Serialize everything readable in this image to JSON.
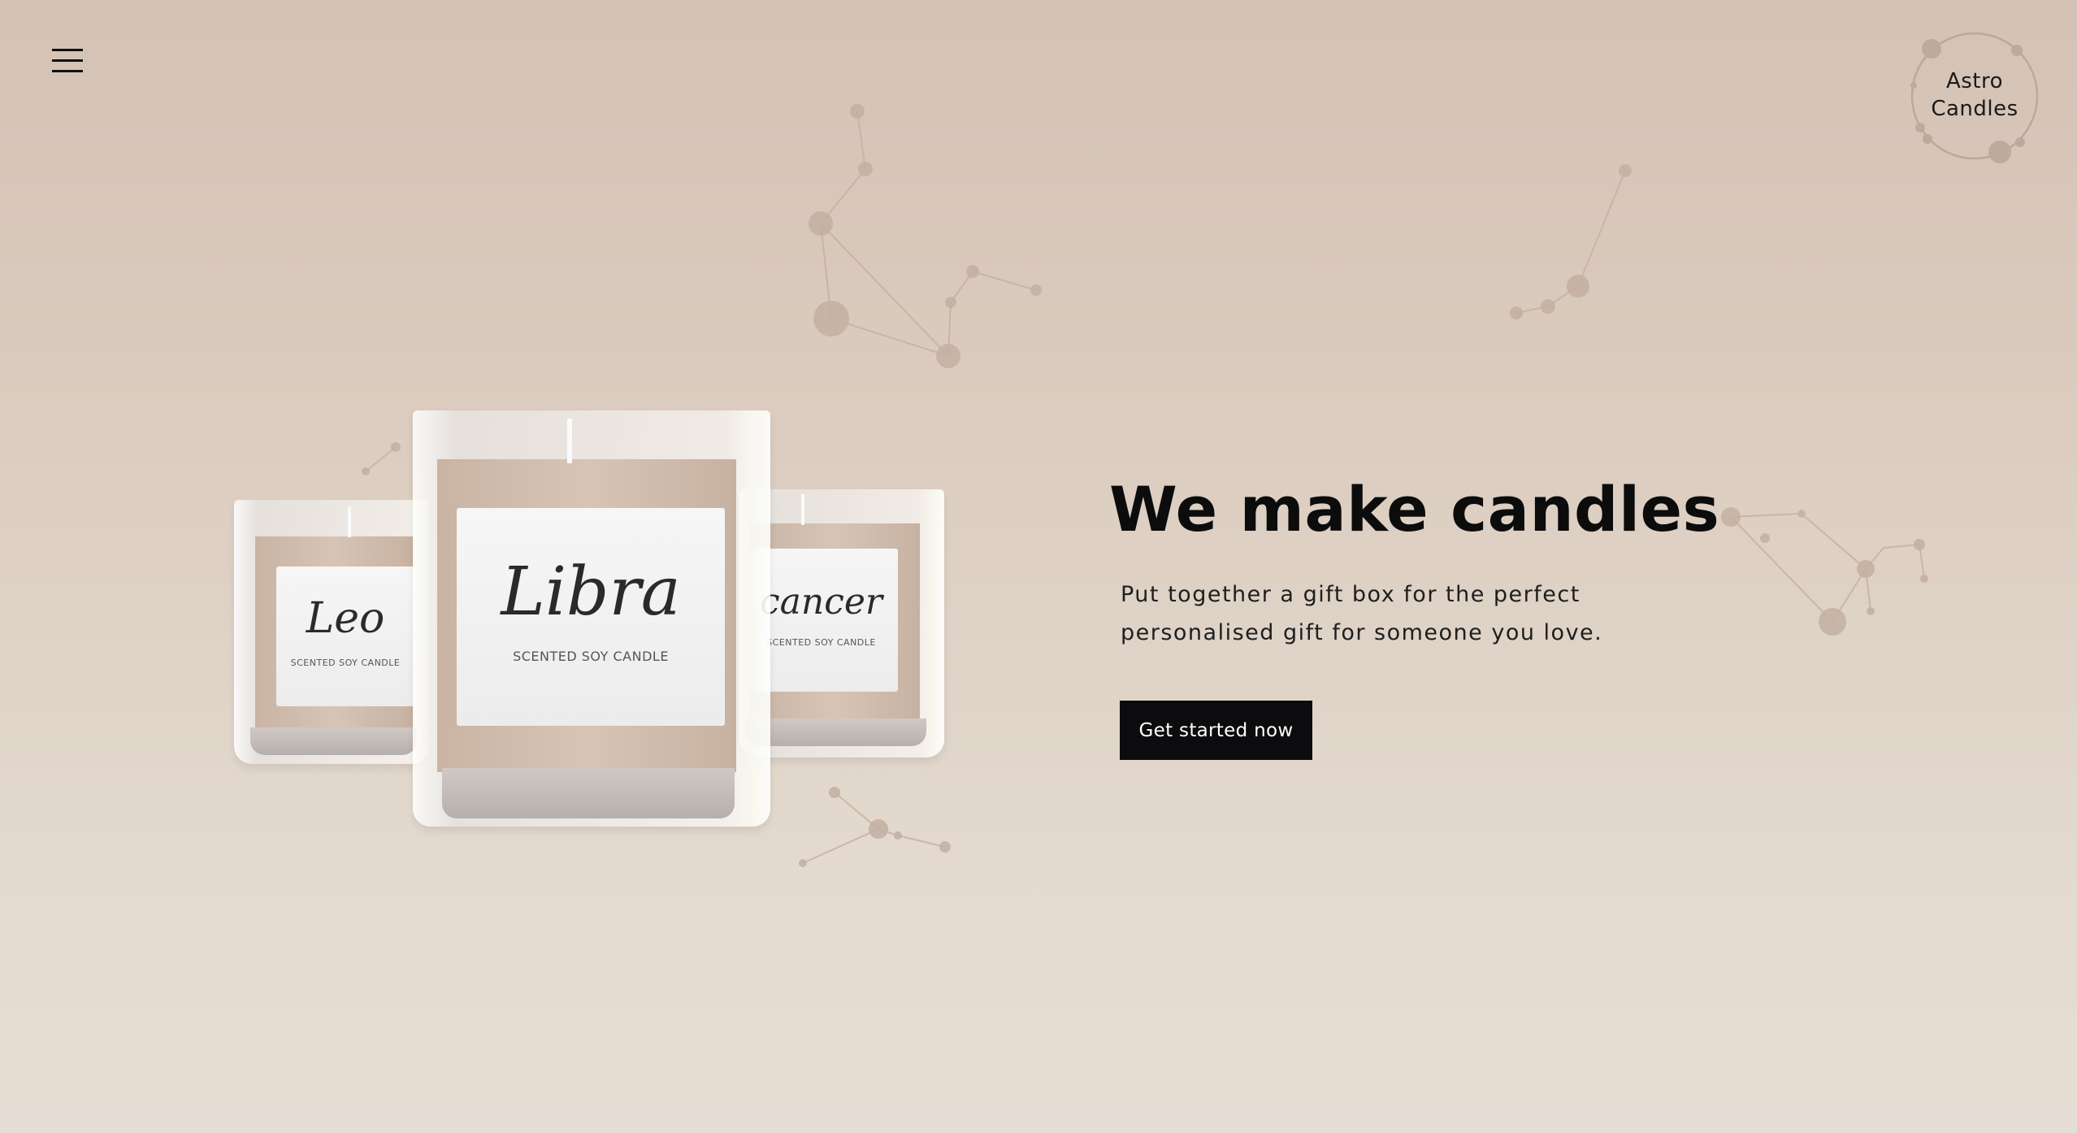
{
  "header": {
    "menu_icon": "hamburger-menu-icon",
    "logo": {
      "line1": "Astro",
      "line2": "Candles"
    }
  },
  "hero": {
    "title": "We make candles",
    "subtitle_line1": "Put together a gift box for the perfect",
    "subtitle_line2": "personalised gift for someone you love.",
    "cta_label": "Get started now"
  },
  "candles": [
    {
      "name": "Leo",
      "script": "Leo",
      "sub": "SCENTED SOY CANDLE"
    },
    {
      "name": "Libra",
      "script": "Libra",
      "sub": "SCENTED SOY CANDLE"
    },
    {
      "name": "Cancer",
      "script": "cancer",
      "sub": "SCENTED SOY CANDLE"
    }
  ],
  "colors": {
    "background_top": "#d4c2b4",
    "background_bottom": "#e6ded4",
    "button_bg": "#0c0c0e",
    "button_text": "#ffffff",
    "text": "#0c0c0c",
    "constellation": "#c4b2a4"
  }
}
